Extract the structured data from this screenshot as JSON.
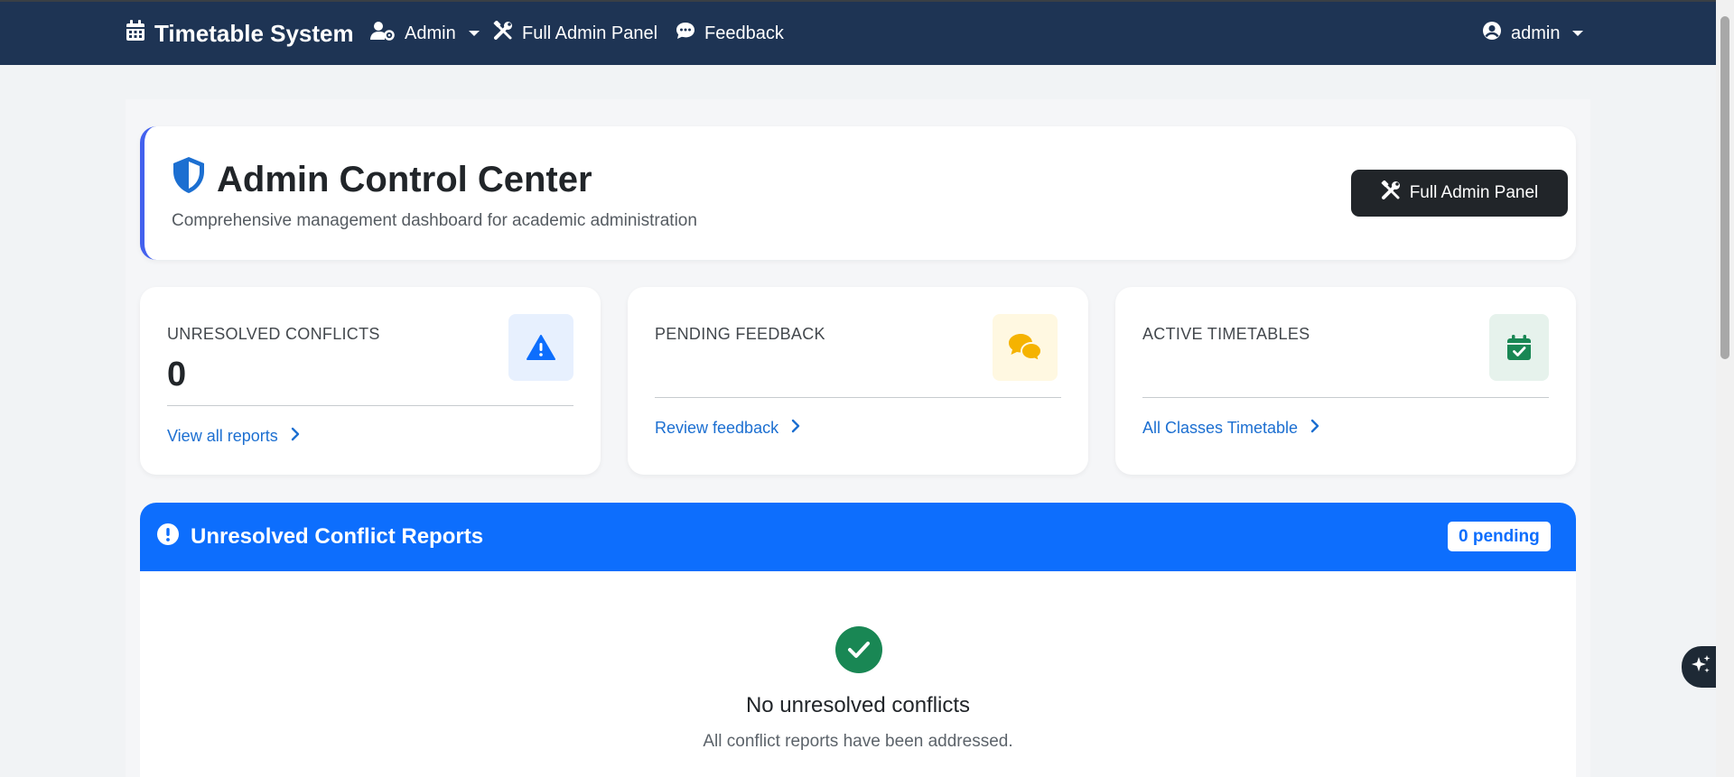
{
  "navbar": {
    "brand": "Timetable System",
    "admin_menu": "Admin",
    "full_admin_panel": "Full Admin Panel",
    "feedback": "Feedback",
    "user_menu": "admin"
  },
  "header": {
    "title": "Admin Control Center",
    "subtitle": "Comprehensive management dashboard for academic administration",
    "button_label": "Full Admin Panel"
  },
  "stats": [
    {
      "label": "UNRESOLVED CONFLICTS",
      "value": "0",
      "link": "View all reports",
      "icon": "warning-triangle-icon",
      "icon_bg": "#e7f0fe",
      "icon_color": "#0d6efd"
    },
    {
      "label": "PENDING FEEDBACK",
      "value": "",
      "link": "Review feedback",
      "icon": "comments-icon",
      "icon_bg": "#fff8e1",
      "icon_color": "#f5b301"
    },
    {
      "label": "ACTIVE TIMETABLES",
      "value": "",
      "link": "All Classes Timetable",
      "icon": "calendar-check-icon",
      "icon_bg": "#e6f2ec",
      "icon_color": "#198754"
    }
  ],
  "conflicts_panel": {
    "title": "Unresolved Conflict Reports",
    "badge": "0 pending",
    "empty_title": "No unresolved conflicts",
    "empty_subtitle": "All conflict reports have been addressed."
  },
  "colors": {
    "navbar": "#1e3454",
    "primary": "#0d6efd",
    "accent_border": "#4361ee",
    "success": "#198754",
    "dark_button": "#212529"
  }
}
